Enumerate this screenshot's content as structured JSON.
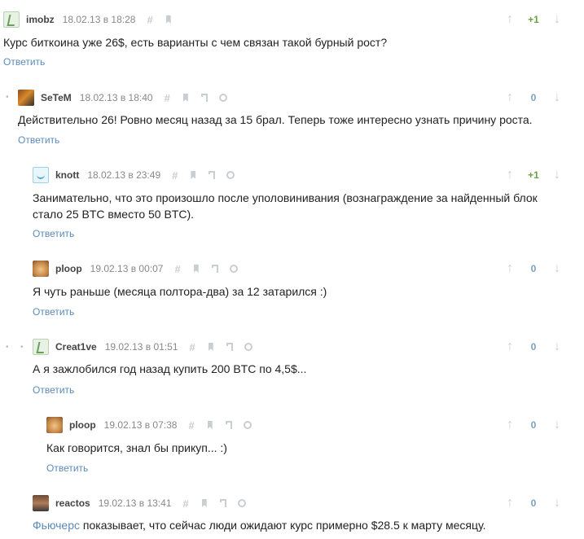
{
  "comments": [
    {
      "username": "imobz",
      "date": "18.02.13 в 18:28",
      "text": "Курс биткоина уже 26$, есть варианты с чем связан такой бурный рост?",
      "reply": "Ответить",
      "votes": "+1"
    },
    {
      "username": "SeTeM",
      "date": "18.02.13 в 18:40",
      "text": "Действительно 26! Ровно месяц назад за 15 брал. Теперь тоже интересно узнать причину роста.",
      "reply": "Ответить",
      "votes": "0"
    },
    {
      "username": "knott",
      "date": "18.02.13 в 23:49",
      "text_line1": "Занимательно, что это произошло после уполовинивания (вознаграждение за найденный блок",
      "text_line2": "стало 25 BTC вместо 50 BTC).",
      "reply": "Ответить",
      "votes": "+1"
    },
    {
      "username": "ploop",
      "date": "19.02.13 в 00:07",
      "text": "Я чуть раньше (месяца полтора-два) за 12 затарился :)",
      "reply": "Ответить",
      "votes": "0"
    },
    {
      "username": "Creat1ve",
      "date": "19.02.13 в 01:51",
      "text": "А я зажлобился год назад купить 200 BTC по 4,5$...",
      "reply": "Ответить",
      "votes": "0"
    },
    {
      "username": "ploop",
      "date": "19.02.13 в 07:38",
      "text": "Как говорится, знал бы прикуп... :)",
      "reply": "Ответить",
      "votes": "0"
    },
    {
      "username": "reactos",
      "date": "19.02.13 в 13:41",
      "text_link": "Фьючерс",
      "text_rest": " показывает, что сейчас люди ожидают курс примерно $28.5 к марту месяцу.",
      "votes": "0"
    }
  ],
  "icons": {
    "up": "arrow-up-icon",
    "down": "arrow-down-icon",
    "hash": "hash-icon",
    "bookmark": "bookmark-icon",
    "parent": "parent-icon",
    "circle": "circle-icon"
  },
  "colors": {
    "link": "#5b8bb8",
    "positive": "#6c9f46",
    "neutral": "#7fa0c0",
    "icon": "#c9ced3"
  }
}
